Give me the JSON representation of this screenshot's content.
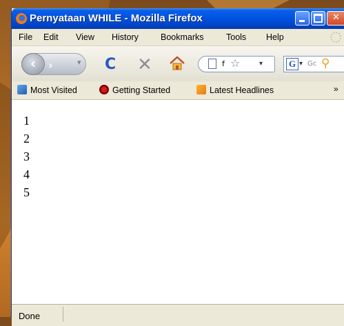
{
  "window": {
    "title": "Pernyataan WHILE - Mozilla Firefox"
  },
  "menu": {
    "items": [
      {
        "label": "File"
      },
      {
        "label": "Edit"
      },
      {
        "label": "View"
      },
      {
        "label": "History"
      },
      {
        "label": "Bookmarks"
      },
      {
        "label": "Tools"
      },
      {
        "label": "Help"
      }
    ]
  },
  "navbar": {
    "url_text": "f",
    "search_text": "Gc"
  },
  "bookmarks": {
    "items": [
      {
        "label": "Most Visited",
        "icon": "bookmarks-folder-icon"
      },
      {
        "label": "Getting Started",
        "icon": "firefox-bookmark-icon"
      },
      {
        "label": "Latest Headlines",
        "icon": "rss-feed-icon"
      }
    ],
    "more": "»"
  },
  "content": {
    "lines": [
      "1",
      "2",
      "3",
      "4",
      "5"
    ]
  },
  "status": {
    "text": "Done"
  },
  "colors": {
    "titlebar": "#0052e0",
    "close_button": "#d24a22",
    "desktop": "#b06a24"
  }
}
